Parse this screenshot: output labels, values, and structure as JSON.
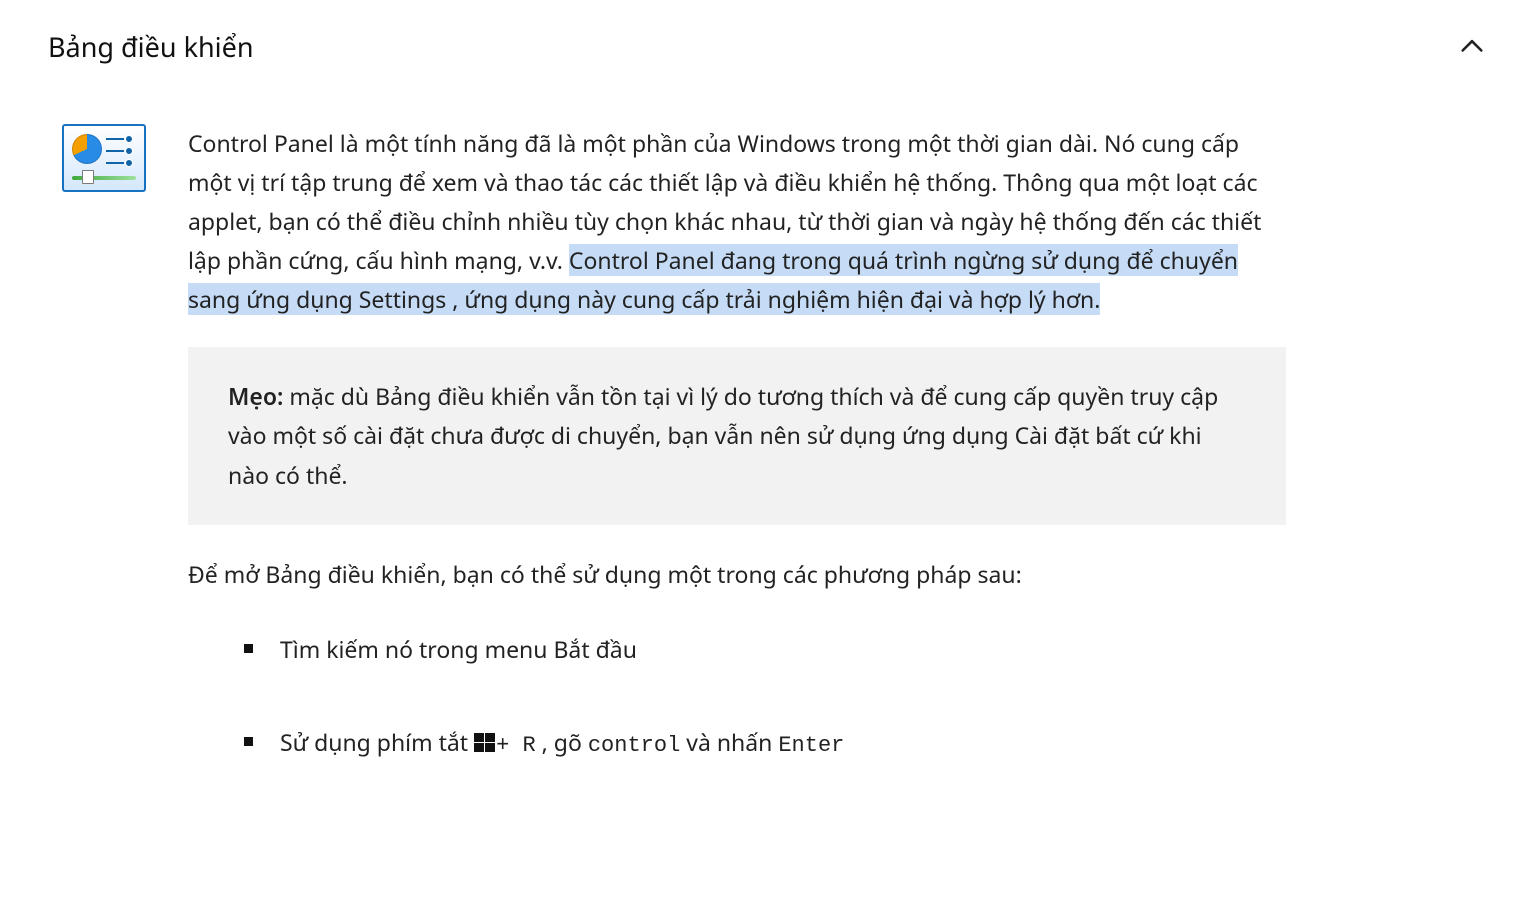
{
  "section": {
    "title": "Bảng điều khiển"
  },
  "main": {
    "p1_a": "Control Panel là một tính năng đã là một phần của Windows trong một thời gian dài. Nó cung cấp một vị trí tập trung để xem và thao tác các thiết lập và điều khiển hệ thống. Thông qua một loạt các applet, bạn có thể điều chỉnh nhiều tùy chọn khác nhau, từ thời gian và ngày hệ thống đến các thiết lập phần cứng, cấu hình mạng, v.v. ",
    "p1_b_hl": "Control Panel đang trong quá trình ngừng sử dụng để chuyển sang ứng dụng Settings , ứng dụng này cung cấp trải nghiệm hiện đại và hợp lý hơn.",
    "tip_label": "Mẹo:",
    "tip_text": "  mặc dù Bảng điều khiển vẫn tồn tại vì lý do tương thích và để cung cấp quyền truy cập vào một số cài đặt chưa được di chuyển, bạn vẫn nên sử dụng ứng dụng Cài đặt bất cứ khi nào có thể.",
    "open_intro": "Để mở Bảng điều khiển, bạn có thể sử dụng một trong các phương pháp sau:",
    "method1": "Tìm kiếm nó trong menu Bắt đầu",
    "method2_a": "Sử dụng phím tắt ",
    "method2_b": "+ R",
    "method2_c": " , gõ ",
    "method2_cmd": "control",
    "method2_d": " và nhấn ",
    "method2_enter": "Enter"
  },
  "icons": {
    "chevron": "chevron-up-icon",
    "cp": "control-panel-icon",
    "winkey": "windows-key-icon"
  }
}
